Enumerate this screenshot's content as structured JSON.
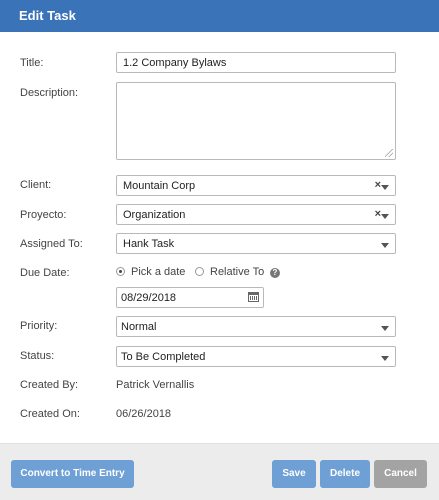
{
  "dialog": {
    "title": "Edit Task"
  },
  "form": {
    "title": {
      "label": "Title:",
      "value": "1.2 Company Bylaws"
    },
    "description": {
      "label": "Description:",
      "value": ""
    },
    "client": {
      "label": "Client:",
      "value": "Mountain Corp",
      "clear": "×"
    },
    "project": {
      "label": "Proyecto:",
      "value": "Organization",
      "clear": "×"
    },
    "assigned_to": {
      "label": "Assigned To:",
      "value": "Hank Task"
    },
    "due_date": {
      "label": "Due Date:",
      "option_pick": "Pick a date",
      "option_relative": "Relative To",
      "selected": "Pick a date",
      "help": "?",
      "value": "08/29/2018"
    },
    "priority": {
      "label": "Priority:",
      "value": "Normal"
    },
    "status": {
      "label": "Status:",
      "value": "To Be Completed"
    },
    "created_by": {
      "label": "Created By:",
      "value": "Patrick Vernallis"
    },
    "created_on": {
      "label": "Created On:",
      "value": "06/26/2018"
    }
  },
  "footer": {
    "convert_label": "Convert to Time Entry",
    "save_label": "Save",
    "delete_label": "Delete",
    "cancel_label": "Cancel"
  },
  "colors": {
    "header": "#3b73b9",
    "primary_button": "#6ea0d6",
    "cancel_button": "#a3a3a3",
    "footer_bg": "#ececec"
  }
}
